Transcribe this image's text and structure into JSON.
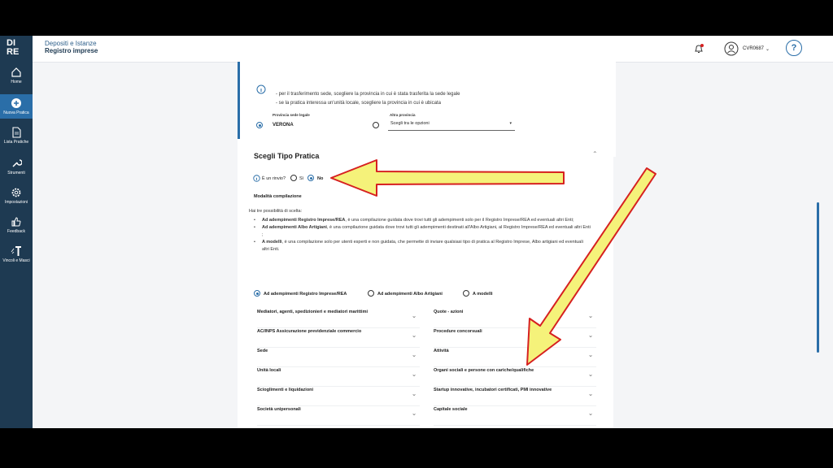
{
  "app": {
    "logo_line1": "DI",
    "logo_line2": "RE",
    "breadcrumb_top": "Depositi e Istanze",
    "breadcrumb_main": "Registro imprese",
    "user_code": "CVR0687",
    "help_label": "?"
  },
  "sidebar": {
    "items": [
      {
        "label": "Home"
      },
      {
        "label": "Nuova Pratica"
      },
      {
        "label": "Lista Pratiche"
      },
      {
        "label": "Strumenti"
      },
      {
        "label": "Impostazioni"
      },
      {
        "label": "Feedback"
      },
      {
        "label": "Vincoli e Masci"
      }
    ]
  },
  "province": {
    "line1": "- per il trasferimento sede, scegliere la provincia in cui è stata trasferita la sede legale",
    "line2": "- se la pratica interessa un'unità locale, scegliere la provincia in cui è ubicata",
    "label_sede": "Provincia sede legale",
    "value_sede": "VERONA",
    "label_altra": "Altra provincia",
    "select_placeholder": "Scegli tra le opzioni"
  },
  "tipo_pratica": {
    "title": "Scegli Tipo Pratica",
    "rinvio_question": "È un rinvio?",
    "opt_si": "Sì",
    "opt_no": "No",
    "modalita": "Modalità compilazione",
    "intro": "Hai tre possibilità di scelta:",
    "b1_bold": "Ad adempimenti Registro Imprese/REA",
    "b1_text": ", è una compilazione guidata dove trovi tutti gli adempimenti solo per il Registro Imprese/REA ed eventuali altri Enti;",
    "b2_bold": "Ad adempimenti Albo Artigiani",
    "b2_text": ", è una compilazione guidata dove trovi tutti gli adempimenti destinati all'Albo Artigiani, al Registro Imprese/REA ed eventuali altri Enti ;",
    "b3_bold": "A modelli",
    "b3_text": ", è una compilazione solo per utenti esperti e non guidata, che permette di inviare qualsiasi tipo di pratica al Registro Imprese, Albo artigiani ed eventuali altri Enti.",
    "mode1": "Ad adempimenti Registro Imprese/REA",
    "mode2": "Ad adempimenti Albo Artigiani",
    "mode3": "A modelli"
  },
  "categories": {
    "left": [
      "Mediatori, agenti, spedizionieri e mediatori marittimi",
      "AC/INPS Assicurazione previdenziale commercio",
      "Sede",
      "Unità locali",
      "Scioglimenti e liquidazioni",
      "Società unipersonali"
    ],
    "right": [
      "Quote - azioni",
      "Procedure concorsuali",
      "Attività",
      "Organi sociali e persone con cariche/qualifiche",
      "Startup innovative, incubatori certificati, PMI innovative",
      "Capitale sociale"
    ]
  },
  "colors": {
    "sidebar": "#1e3a52",
    "accent": "#2a6ea8",
    "arrow_fill": "#f5f27a",
    "arrow_stroke": "#d62020"
  }
}
